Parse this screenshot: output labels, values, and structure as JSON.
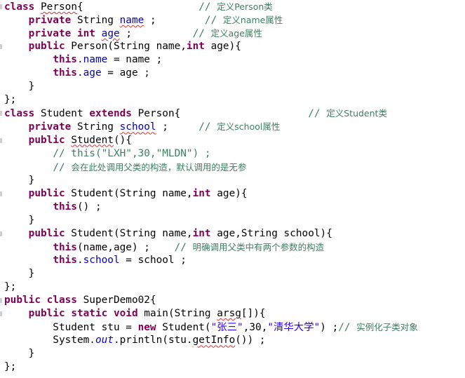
{
  "editor": {
    "lines": [
      [
        {
          "t": "class",
          "s": "kw"
        },
        {
          "t": " "
        },
        {
          "t": "Person",
          "s": "sq"
        },
        {
          "t": "{                   "
        },
        {
          "t": "// ",
          "s": "cm"
        },
        {
          "t": "定义Person类",
          "s": "cmi"
        }
      ],
      [
        {
          "t": "    "
        },
        {
          "t": "private",
          "s": "kw"
        },
        {
          "t": " String "
        },
        {
          "t": "name",
          "s": "fld sq"
        },
        {
          "t": " ;        "
        },
        {
          "t": "// ",
          "s": "cm"
        },
        {
          "t": "定义name属性",
          "s": "cmi"
        }
      ],
      [
        {
          "t": "    "
        },
        {
          "t": "private",
          "s": "kw"
        },
        {
          "t": " "
        },
        {
          "t": "int",
          "s": "kw"
        },
        {
          "t": " "
        },
        {
          "t": "age",
          "s": "fld sq"
        },
        {
          "t": " ;          "
        },
        {
          "t": "// ",
          "s": "cm"
        },
        {
          "t": "定义age属性",
          "s": "cmi"
        }
      ],
      [
        {
          "t": "    "
        },
        {
          "t": "public",
          "s": "kw"
        },
        {
          "t": " Person(String name,"
        },
        {
          "t": "int",
          "s": "kw"
        },
        {
          "t": " age){"
        }
      ],
      [
        {
          "t": "        "
        },
        {
          "t": "this",
          "s": "kw"
        },
        {
          "t": "."
        },
        {
          "t": "name",
          "s": "fld"
        },
        {
          "t": " = name ;"
        }
      ],
      [
        {
          "t": "        "
        },
        {
          "t": "this",
          "s": "kw"
        },
        {
          "t": "."
        },
        {
          "t": "age",
          "s": "fld"
        },
        {
          "t": " = age ;"
        }
      ],
      [
        {
          "t": "    }"
        }
      ],
      [
        {
          "t": "};"
        }
      ],
      [
        {
          "t": "class",
          "s": "kw"
        },
        {
          "t": " Student "
        },
        {
          "t": "extends",
          "s": "kw"
        },
        {
          "t": " Person{                     "
        },
        {
          "t": "// ",
          "s": "cm"
        },
        {
          "t": "定义Student类",
          "s": "cmi"
        }
      ],
      [
        {
          "t": "    "
        },
        {
          "t": "private",
          "s": "kw"
        },
        {
          "t": " String "
        },
        {
          "t": "school",
          "s": "fld sq"
        },
        {
          "t": " ;     "
        },
        {
          "t": "// ",
          "s": "cm"
        },
        {
          "t": "定义school属性",
          "s": "cmi"
        }
      ],
      [
        {
          "t": "    "
        },
        {
          "t": "public",
          "s": "kw"
        },
        {
          "t": " "
        },
        {
          "t": "Student",
          "s": "sq"
        },
        {
          "t": "(){"
        }
      ],
      [
        {
          "t": "        "
        },
        {
          "t": "// this(\"LXH\",30,\"MLDN\") ;",
          "s": "cm"
        }
      ],
      [
        {
          "t": "        "
        },
        {
          "t": "// ",
          "s": "cm"
        },
        {
          "t": "会在此处调用父类的构造，默认调用的是无参",
          "s": "cmi"
        }
      ],
      [
        {
          "t": "    }"
        }
      ],
      [
        {
          "t": "    "
        },
        {
          "t": "public",
          "s": "kw"
        },
        {
          "t": " Student(String name,"
        },
        {
          "t": "int",
          "s": "kw"
        },
        {
          "t": " age){"
        }
      ],
      [
        {
          "t": "        "
        },
        {
          "t": "this",
          "s": "kw"
        },
        {
          "t": "() ;"
        }
      ],
      [
        {
          "t": "    }"
        }
      ],
      [
        {
          "t": "    "
        },
        {
          "t": "public",
          "s": "kw"
        },
        {
          "t": " Student(String name,"
        },
        {
          "t": "int",
          "s": "kw"
        },
        {
          "t": " age,String school){"
        }
      ],
      [
        {
          "t": "        "
        },
        {
          "t": "this",
          "s": "kw"
        },
        {
          "t": "(name,age) ;    "
        },
        {
          "t": "// ",
          "s": "cm"
        },
        {
          "t": "明确调用父类中有两个参数的构造",
          "s": "cmi"
        }
      ],
      [
        {
          "t": "        "
        },
        {
          "t": "this",
          "s": "kw"
        },
        {
          "t": "."
        },
        {
          "t": "school",
          "s": "fld"
        },
        {
          "t": " = school ;"
        }
      ],
      [
        {
          "t": "    }"
        }
      ],
      [
        {
          "t": "};"
        }
      ],
      [
        {
          "t": "public",
          "s": "kw"
        },
        {
          "t": " "
        },
        {
          "t": "class",
          "s": "kw"
        },
        {
          "t": " SuperDemo02{"
        }
      ],
      [
        {
          "t": "    "
        },
        {
          "t": "public",
          "s": "kw"
        },
        {
          "t": " "
        },
        {
          "t": "static",
          "s": "kw"
        },
        {
          "t": " "
        },
        {
          "t": "void",
          "s": "kw"
        },
        {
          "t": " main(String "
        },
        {
          "t": "arsg",
          "s": "sq"
        },
        {
          "t": "[]){"
        }
      ],
      [
        {
          "t": "        Student stu = "
        },
        {
          "t": "new",
          "s": "kw"
        },
        {
          "t": " Student("
        },
        {
          "t": "\"张三\"",
          "s": "str"
        },
        {
          "t": ",30,"
        },
        {
          "t": "\"清华大学\"",
          "s": "str"
        },
        {
          "t": ") ;"
        },
        {
          "t": "// ",
          "s": "cm"
        },
        {
          "t": "实例化子类对象",
          "s": "cmi"
        }
      ],
      [
        {
          "t": "        System."
        },
        {
          "t": "out",
          "s": "fld it"
        },
        {
          "t": ".println(stu."
        },
        {
          "t": "getInfo",
          "s": "sq"
        },
        {
          "t": "()) ;"
        }
      ],
      [
        {
          "t": "    }"
        }
      ],
      [
        {
          "t": "};"
        }
      ]
    ]
  }
}
